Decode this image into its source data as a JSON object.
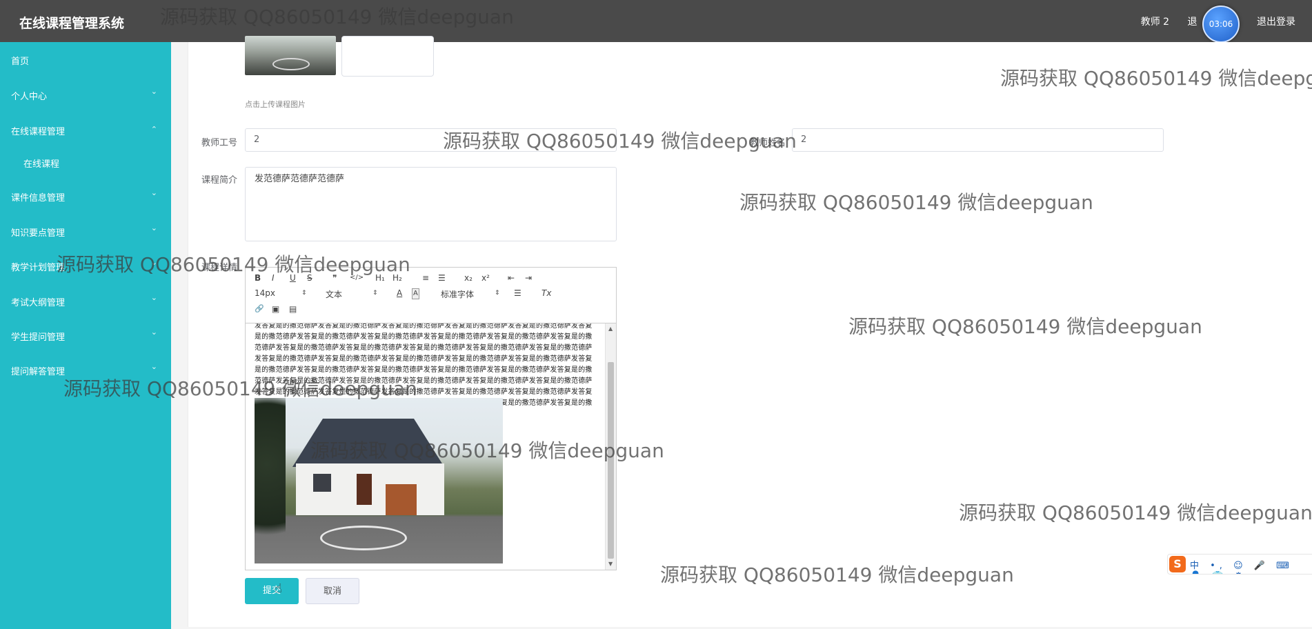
{
  "app": {
    "title": "在线课程管理系统",
    "user_name": "教师 2",
    "menu_partial": "退",
    "logout_label": "退出登录",
    "clock": "03:06"
  },
  "sidebar": {
    "items": [
      {
        "label": "首页",
        "chevron": ""
      },
      {
        "label": "个人中心",
        "chevron": "⌄"
      },
      {
        "label": "在线课程管理",
        "chevron": "⌃"
      },
      {
        "label": "在线课程",
        "chevron": ""
      },
      {
        "label": "课件信息管理",
        "chevron": "⌄"
      },
      {
        "label": "知识要点管理",
        "chevron": "⌄"
      },
      {
        "label": "教学计划管理",
        "chevron": "⌄"
      },
      {
        "label": "考试大纲管理",
        "chevron": "⌄"
      },
      {
        "label": "学生提问管理",
        "chevron": "⌄"
      },
      {
        "label": "提问解答管理",
        "chevron": "⌄"
      }
    ]
  },
  "form": {
    "upload_hint": "点击上传课程图片",
    "teacher_id_label": "教师工号",
    "teacher_id_value": "2",
    "teacher_name_label": "教师姓名",
    "teacher_name_value": "2",
    "intro_label": "课程简介",
    "intro_value": "发范德萨范德萨范德萨",
    "detail_label": "课程详情",
    "submit_label": "提交",
    "cancel_label": "取消"
  },
  "editor": {
    "toolbar": {
      "bold": "B",
      "italic": "I",
      "underline": "U",
      "strike": "S",
      "quote": "❞",
      "code": "</>",
      "h1": "H₁",
      "h2": "H₂",
      "ordered_list": "≡",
      "bullet_list": "☰",
      "subscript": "x₂",
      "superscript": "x²",
      "outdent": "⇤",
      "indent": "⇥",
      "font_size": "14px",
      "format": "文本",
      "font_color": "A",
      "bg_color": "A",
      "font_family": "标准字体",
      "align": "☰",
      "clear": "Tx",
      "link": "🔗",
      "image": "▣",
      "video": "▤"
    },
    "content_text": "发答复是的撒范德萨发答复是的撒范德萨发答复是的撒范德萨发答复是的撒范德萨发答复是的撒范德萨发答复是的撒范德萨发答复是的撒范德萨发答复是的撒范德萨发答复是的撒范德萨发答复是的撒范德萨发答复是的撒范德萨发答复是的撒范德萨发答复是的撒范德萨发答复是的撒范德萨发答复是的撒范德萨发答复是的撒范德萨发答复是的撒范德萨发答复是的撒范德萨发答复是的撒范德萨发答复是的撒范德萨发答复是的撒范德萨发答复是的撒范德萨发答复是的撒范德萨发答复是的撒范德萨发答复是的撒范德萨发答复是的撒范德萨发答复是的撒范德萨发答复是的撒范德萨发答复是的撒范德萨发答复是的撒范德萨发答复是的撒范德萨发答复是的撒范德萨发答复是的撒范德萨发答复是的撒范德萨发答复是的撒范德萨发答复是的撒范德萨发答复是的撒范德萨发答复是的撒范德萨发答复是的撒范德萨发答复是的撒范德萨发答复是的撒范德萨发答复是的撒范德萨发答复是的撒范德萨发答复是的撒"
  },
  "watermark": {
    "text": "源码获取 QQ86050149 微信deepguan"
  },
  "ime": {
    "logo": "S",
    "items": "中 •, ☺ 🎤 ⌨ 👤 👕 ⚙"
  },
  "colors": {
    "sidebar": "#23bcc8",
    "topbar": "#4a4a4a",
    "primary": "#23bcc8"
  }
}
